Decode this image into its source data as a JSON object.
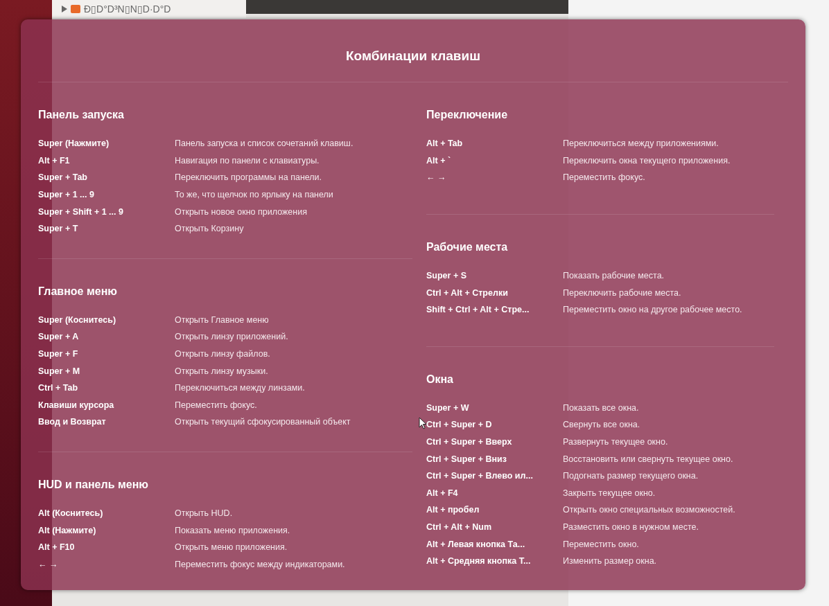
{
  "background": {
    "folder_label": "Ð▯D°D³N▯N▯D·D°D"
  },
  "overlay": {
    "title": "Комбинации клавиш",
    "columns": [
      {
        "sections": [
          {
            "heading": "Панель запуска",
            "shortcuts": [
              {
                "keys": "Super (Нажмите)",
                "description": "Панель запуска и список сочетаний клавиш."
              },
              {
                "keys": "Alt + F1",
                "description": "Навигация по панели с клавиатуры."
              },
              {
                "keys": "Super + Tab",
                "description": "Переключить программы на панели."
              },
              {
                "keys": "Super + 1 ... 9",
                "description": "То же, что щелчок по ярлыку на панели"
              },
              {
                "keys": "Super + Shift + 1 ... 9",
                "description": "Открыть новое окно приложения"
              },
              {
                "keys": "Super + T",
                "description": "Открыть Корзину"
              }
            ]
          },
          {
            "heading": "Главное меню",
            "shortcuts": [
              {
                "keys": "Super (Коснитесь)",
                "description": "Открыть Главное меню"
              },
              {
                "keys": "Super + A",
                "description": "Открыть линзу приложений."
              },
              {
                "keys": "Super + F",
                "description": "Открыть линзу файлов."
              },
              {
                "keys": "Super + M",
                "description": "Открыть линзу музыки."
              },
              {
                "keys": "Ctrl + Tab",
                "description": "Переключиться между линзами."
              },
              {
                "keys": "Клавиши курсора",
                "description": "Переместить фокус."
              },
              {
                "keys": "Ввод и Возврат",
                "description": "Открыть текущий сфокусированный объект"
              }
            ]
          },
          {
            "heading": "HUD и панель меню",
            "shortcuts": [
              {
                "keys": "Alt (Коснитесь)",
                "description": "Открыть HUD."
              },
              {
                "keys": "Alt (Нажмите)",
                "description": "Показать меню приложения."
              },
              {
                "keys": "Alt + F10",
                "description": "Открыть меню приложения."
              },
              {
                "keys": "← →",
                "description": "Переместить фокус между индикаторами."
              }
            ]
          }
        ]
      },
      {
        "sections": [
          {
            "heading": "Переключение",
            "shortcuts": [
              {
                "keys": "Alt + Tab",
                "description": "Переключиться между приложениями."
              },
              {
                "keys": "Alt + `",
                "description": "Переключить окна текущего приложения."
              },
              {
                "keys": "← →",
                "description": "Переместить фокус."
              }
            ]
          },
          {
            "heading": "Рабочие места",
            "shortcuts": [
              {
                "keys": "Super + S",
                "description": "Показать рабочие места."
              },
              {
                "keys": "Ctrl + Alt + Стрелки",
                "description": "Переключить рабочие места."
              },
              {
                "keys": "Shift + Ctrl + Alt + Стре...",
                "description": "Переместить окно на другое рабочее место."
              }
            ]
          },
          {
            "heading": "Окна",
            "shortcuts": [
              {
                "keys": "Super + W",
                "description": "Показать все окна."
              },
              {
                "keys": "Ctrl + Super + D",
                "description": "Свернуть все окна."
              },
              {
                "keys": "Ctrl + Super + Вверх",
                "description": "Развернуть текущее окно."
              },
              {
                "keys": "Ctrl + Super + Вниз",
                "description": "Восстановить или свернуть текущее окно."
              },
              {
                "keys": "Ctrl + Super + Влево ил...",
                "description": "Подогнать размер текущего окна."
              },
              {
                "keys": "Alt + F4",
                "description": "Закрыть текущее окно."
              },
              {
                "keys": "Alt + пробел",
                "description": "Открыть окно специальных возможностей."
              },
              {
                "keys": "Ctrl + Alt + Num",
                "description": "Разместить окно в нужном месте."
              },
              {
                "keys": "Alt + Левая кнопка Та...",
                "description": "Переместить окно."
              },
              {
                "keys": "Alt + Средняя кнопка Т...",
                "description": "Изменить размер окна."
              }
            ]
          }
        ]
      }
    ]
  }
}
